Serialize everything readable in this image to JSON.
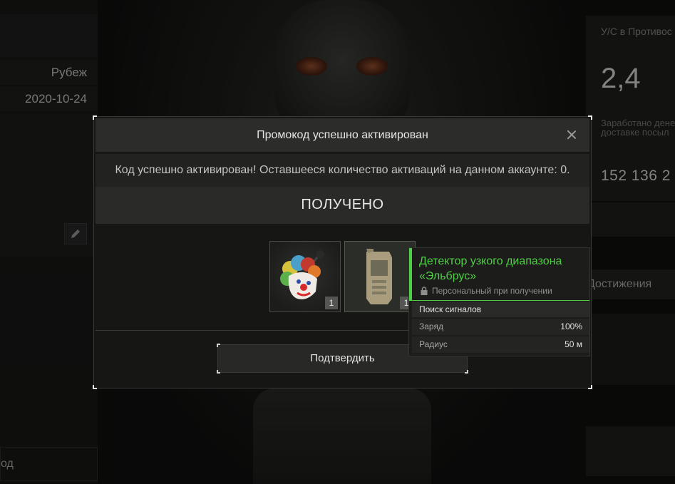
{
  "left_panel": {
    "row1": "Рубеж",
    "row2": "2020-10-24",
    "bottom_label": "од"
  },
  "right_panel": {
    "label_top": "У/С в Противос",
    "big_value": "2,4",
    "label_earned_line1": "Заработано дене",
    "label_earned_line2": "доставке посыл",
    "number": "152 136 2",
    "achievements": "Достижения"
  },
  "dialog": {
    "title": "Промокод успешно активирован",
    "message": "Код успешно активирован! Оставшееся количество активаций на данном аккаунте: 0.",
    "received": "ПОЛУЧЕНО",
    "items": [
      {
        "count": "1",
        "icon": "clown-mask-icon"
      },
      {
        "count": "1",
        "icon": "detector-icon"
      }
    ],
    "confirm_label": "Подтвердить"
  },
  "tooltip": {
    "title_line1": "Детектор узкого диапазона",
    "title_line2": "«Эльбрус»",
    "personal": "Персональный при получении",
    "section": "Поиск сигналов",
    "stats": [
      {
        "label": "Заряд",
        "value": "100%"
      },
      {
        "label": "Радиус",
        "value": "50 м"
      }
    ],
    "accent_color": "#4fcf45"
  }
}
